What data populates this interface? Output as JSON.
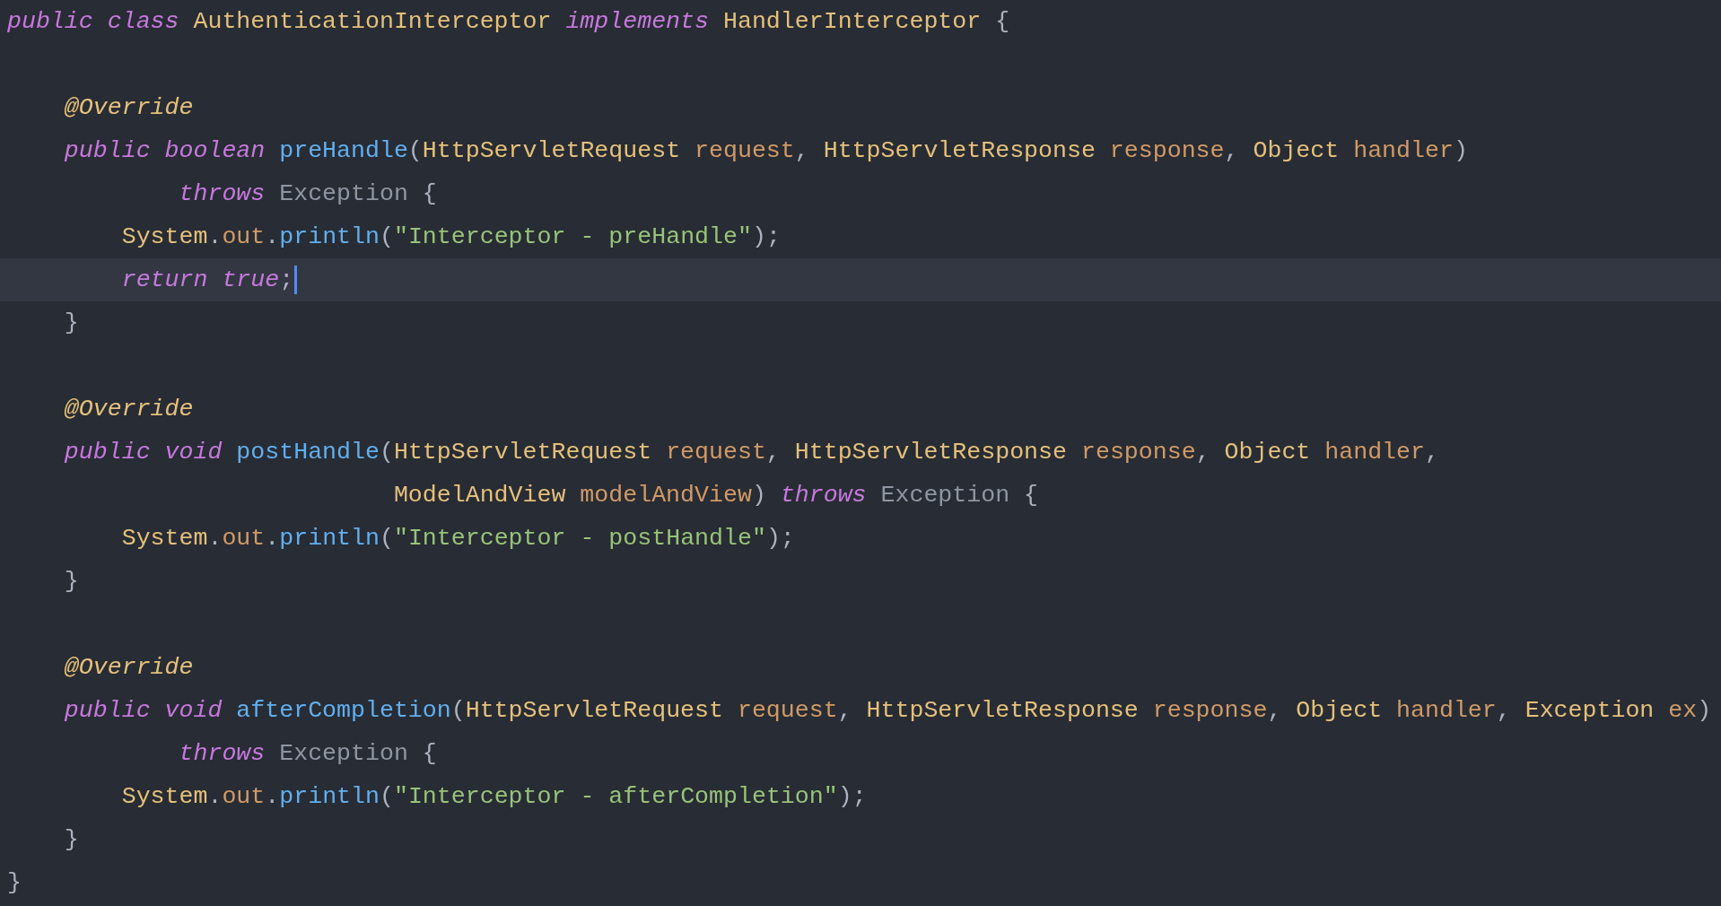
{
  "editor": {
    "lines": [
      {
        "current": false,
        "caret": false,
        "tokens": [
          {
            "kind": "kw",
            "text": "public class"
          },
          {
            "kind": "type",
            "text": " AuthenticationInterceptor "
          },
          {
            "kind": "kw",
            "text": "implements"
          },
          {
            "kind": "type",
            "text": " HandlerInterceptor"
          },
          {
            "kind": "plain",
            "text": " {"
          }
        ]
      },
      {
        "current": false,
        "caret": false
      },
      {
        "current": false,
        "caret": false,
        "tokens": [
          {
            "kind": "ann",
            "text": "    @Override"
          }
        ]
      },
      {
        "current": false,
        "caret": false,
        "tokens": [
          {
            "kind": "kw",
            "text": "    public boolean"
          },
          {
            "kind": "method",
            "text": " preHandle"
          },
          {
            "kind": "plain",
            "text": "("
          },
          {
            "kind": "type",
            "text": "HttpServletRequest"
          },
          {
            "kind": "param",
            "text": " request"
          },
          {
            "kind": "plain",
            "text": ", "
          },
          {
            "kind": "type",
            "text": "HttpServletResponse"
          },
          {
            "kind": "param",
            "text": " response"
          },
          {
            "kind": "plain",
            "text": ", "
          },
          {
            "kind": "type",
            "text": "Object"
          },
          {
            "kind": "param",
            "text": " handler"
          },
          {
            "kind": "plain",
            "text": ")"
          }
        ]
      },
      {
        "current": false,
        "caret": false,
        "tokens": [
          {
            "kind": "kw",
            "text": "            throws"
          },
          {
            "kind": "dim",
            "text": " Exception"
          },
          {
            "kind": "plain",
            "text": " {"
          }
        ]
      },
      {
        "current": false,
        "caret": false,
        "tokens": [
          {
            "kind": "type",
            "text": "        System"
          },
          {
            "kind": "plain",
            "text": "."
          },
          {
            "kind": "field",
            "text": "out"
          },
          {
            "kind": "plain",
            "text": "."
          },
          {
            "kind": "method",
            "text": "println"
          },
          {
            "kind": "plain",
            "text": "("
          },
          {
            "kind": "str",
            "text": "\"Interceptor - preHandle\""
          },
          {
            "kind": "plain",
            "text": ");"
          }
        ]
      },
      {
        "current": true,
        "caret": true,
        "tokens": [
          {
            "kind": "kw",
            "text": "        return true"
          },
          {
            "kind": "plain",
            "text": ";"
          }
        ]
      },
      {
        "current": false,
        "caret": false,
        "tokens": [
          {
            "kind": "plain",
            "text": "    }"
          }
        ]
      },
      {
        "current": false,
        "caret": false
      },
      {
        "current": false,
        "caret": false,
        "tokens": [
          {
            "kind": "ann",
            "text": "    @Override"
          }
        ]
      },
      {
        "current": false,
        "caret": false,
        "tokens": [
          {
            "kind": "kw",
            "text": "    public void"
          },
          {
            "kind": "method",
            "text": " postHandle"
          },
          {
            "kind": "plain",
            "text": "("
          },
          {
            "kind": "type",
            "text": "HttpServletRequest"
          },
          {
            "kind": "param",
            "text": " request"
          },
          {
            "kind": "plain",
            "text": ", "
          },
          {
            "kind": "type",
            "text": "HttpServletResponse"
          },
          {
            "kind": "param",
            "text": " response"
          },
          {
            "kind": "plain",
            "text": ", "
          },
          {
            "kind": "type",
            "text": "Object"
          },
          {
            "kind": "param",
            "text": " handler"
          },
          {
            "kind": "plain",
            "text": ","
          }
        ]
      },
      {
        "current": false,
        "caret": false,
        "tokens": [
          {
            "kind": "type",
            "text": "                           ModelAndView"
          },
          {
            "kind": "param",
            "text": " modelAndView"
          },
          {
            "kind": "plain",
            "text": ") "
          },
          {
            "kind": "kw",
            "text": "throws"
          },
          {
            "kind": "dim",
            "text": " Exception"
          },
          {
            "kind": "plain",
            "text": " {"
          }
        ]
      },
      {
        "current": false,
        "caret": false,
        "tokens": [
          {
            "kind": "type",
            "text": "        System"
          },
          {
            "kind": "plain",
            "text": "."
          },
          {
            "kind": "field",
            "text": "out"
          },
          {
            "kind": "plain",
            "text": "."
          },
          {
            "kind": "method",
            "text": "println"
          },
          {
            "kind": "plain",
            "text": "("
          },
          {
            "kind": "str",
            "text": "\"Interceptor - postHandle\""
          },
          {
            "kind": "plain",
            "text": ");"
          }
        ]
      },
      {
        "current": false,
        "caret": false,
        "tokens": [
          {
            "kind": "plain",
            "text": "    }"
          }
        ]
      },
      {
        "current": false,
        "caret": false
      },
      {
        "current": false,
        "caret": false,
        "tokens": [
          {
            "kind": "ann",
            "text": "    @Override"
          }
        ]
      },
      {
        "current": false,
        "caret": false,
        "tokens": [
          {
            "kind": "kw",
            "text": "    public void"
          },
          {
            "kind": "method",
            "text": " afterCompletion"
          },
          {
            "kind": "plain",
            "text": "("
          },
          {
            "kind": "type",
            "text": "HttpServletRequest"
          },
          {
            "kind": "param",
            "text": " request"
          },
          {
            "kind": "plain",
            "text": ", "
          },
          {
            "kind": "type",
            "text": "HttpServletResponse"
          },
          {
            "kind": "param",
            "text": " response"
          },
          {
            "kind": "plain",
            "text": ", "
          },
          {
            "kind": "type",
            "text": "Object"
          },
          {
            "kind": "param",
            "text": " handler"
          },
          {
            "kind": "plain",
            "text": ", "
          },
          {
            "kind": "type",
            "text": "Exception"
          },
          {
            "kind": "param",
            "text": " ex"
          },
          {
            "kind": "plain",
            "text": ")"
          }
        ]
      },
      {
        "current": false,
        "caret": false,
        "tokens": [
          {
            "kind": "kw",
            "text": "            throws"
          },
          {
            "kind": "dim",
            "text": " Exception"
          },
          {
            "kind": "plain",
            "text": " {"
          }
        ]
      },
      {
        "current": false,
        "caret": false,
        "tokens": [
          {
            "kind": "type",
            "text": "        System"
          },
          {
            "kind": "plain",
            "text": "."
          },
          {
            "kind": "field",
            "text": "out"
          },
          {
            "kind": "plain",
            "text": "."
          },
          {
            "kind": "method",
            "text": "println"
          },
          {
            "kind": "plain",
            "text": "("
          },
          {
            "kind": "str",
            "text": "\"Interceptor - afterCompletion\""
          },
          {
            "kind": "plain",
            "text": ");"
          }
        ]
      },
      {
        "current": false,
        "caret": false,
        "tokens": [
          {
            "kind": "plain",
            "text": "    }"
          }
        ]
      },
      {
        "current": false,
        "caret": false,
        "tokens": [
          {
            "kind": "plain",
            "text": "}"
          }
        ]
      }
    ]
  }
}
